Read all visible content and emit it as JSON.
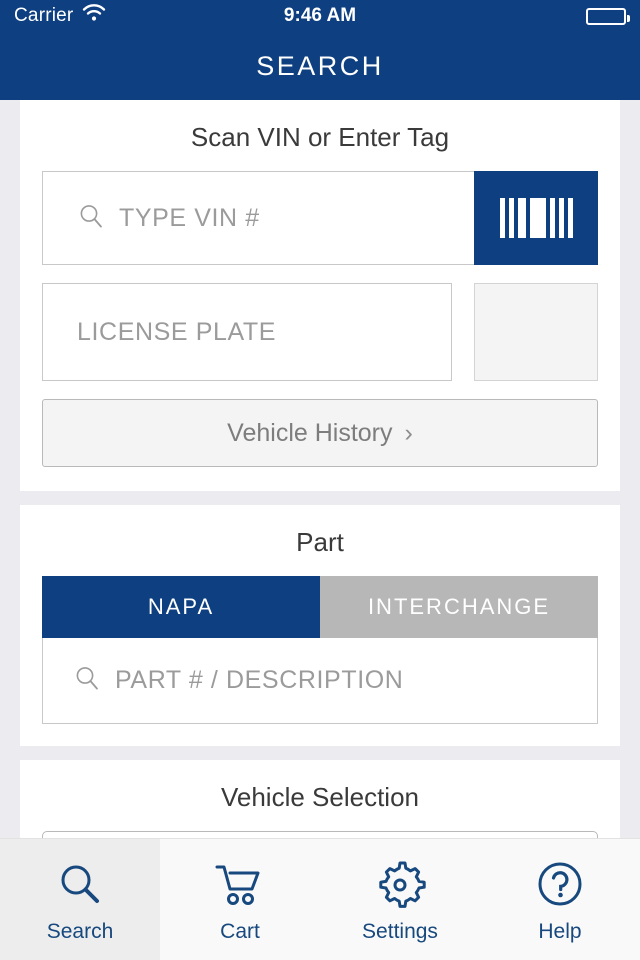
{
  "status_bar": {
    "carrier": "Carrier",
    "wifi_icon": "wifi-icon",
    "time": "9:46 AM",
    "battery_icon": "battery-full-icon"
  },
  "nav": {
    "title": "SEARCH"
  },
  "colors": {
    "navy": "#0e3f80",
    "page_bg": "#ebebf0",
    "card_bg": "#ffffff",
    "inactive_tab": "#b7b7b7",
    "placeholder_text": "#9b9b9b",
    "tabbar_selected_bg": "#ededed"
  },
  "vin_section": {
    "title": "Scan VIN or Enter Tag",
    "vin_input": {
      "placeholder": "TYPE VIN #",
      "value": "",
      "icon": "search-icon"
    },
    "barcode_button": {
      "icon": "barcode-icon",
      "label": ""
    },
    "plate_input": {
      "placeholder": "LICENSE PLATE",
      "value": ""
    },
    "plate_camera_button": {
      "icon": "camera-icon",
      "label": ""
    },
    "history_button": {
      "label": "Vehicle History",
      "chevron": "›",
      "icon": "chevron-right-icon"
    }
  },
  "part_section": {
    "title": "Part",
    "tabs": [
      {
        "label": "NAPA",
        "active": true
      },
      {
        "label": "INTERCHANGE",
        "active": false
      }
    ],
    "part_input": {
      "placeholder": "PART # / DESCRIPTION",
      "value": "",
      "icon": "search-icon"
    }
  },
  "vehicle_section": {
    "title": "Vehicle Selection"
  },
  "tabbar": {
    "items": [
      {
        "label": "Search",
        "icon": "search-icon",
        "selected": true
      },
      {
        "label": "Cart",
        "icon": "cart-icon",
        "selected": false
      },
      {
        "label": "Settings",
        "icon": "gear-icon",
        "selected": false
      },
      {
        "label": "Help",
        "icon": "question-circle-icon",
        "selected": false
      }
    ]
  }
}
